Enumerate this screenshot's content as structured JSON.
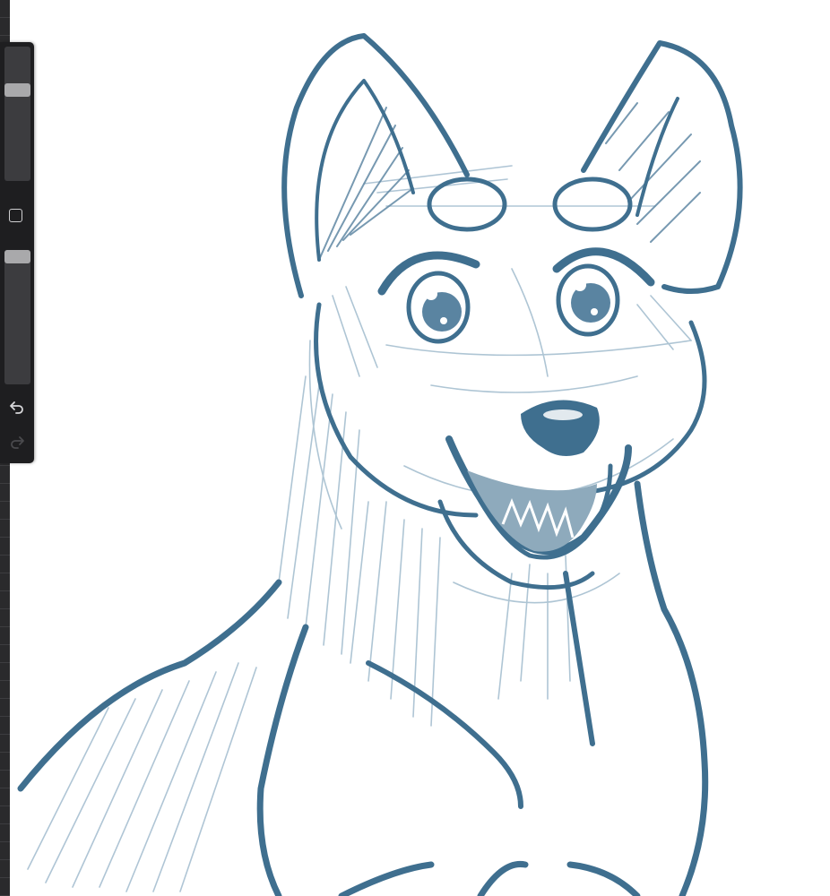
{
  "app": {
    "accent_stroke": "#3f6f8f",
    "shade_stroke": "#9bb6c8"
  },
  "sidebar": {
    "brush_size": {
      "icon": "brush-size-slider",
      "value": 0.7
    },
    "modify_button": {
      "icon": "square-outline-icon"
    },
    "brush_opacity": {
      "icon": "brush-opacity-slider",
      "value": 1.0
    },
    "undo": {
      "icon": "undo-arrow-icon",
      "enabled": true
    },
    "redo": {
      "icon": "redo-arrow-icon",
      "enabled": false
    }
  },
  "canvas": {
    "subject": "sketch",
    "background": "#ffffff"
  }
}
